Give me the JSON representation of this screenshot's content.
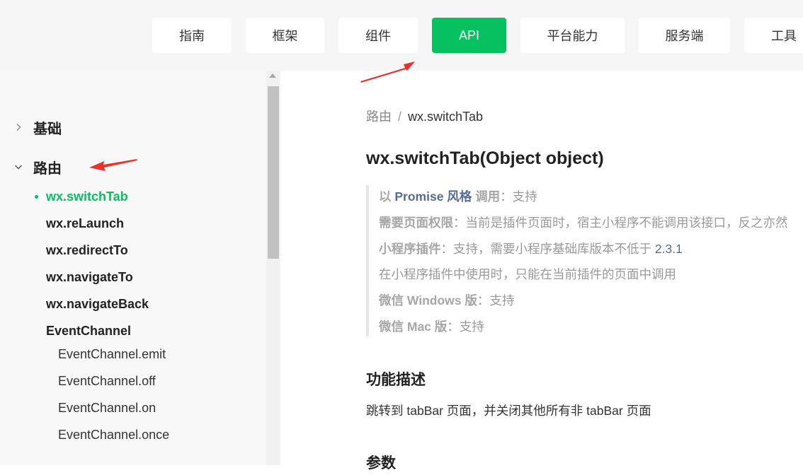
{
  "topnav": {
    "tabs": [
      {
        "label": "指南",
        "active": false
      },
      {
        "label": "框架",
        "active": false
      },
      {
        "label": "组件",
        "active": false
      },
      {
        "label": "API",
        "active": true
      },
      {
        "label": "平台能力",
        "active": false
      },
      {
        "label": "服务端",
        "active": false
      },
      {
        "label": "工具",
        "active": false
      }
    ],
    "accent_color": "#07c160"
  },
  "sidebar": {
    "sections": [
      {
        "label": "基础",
        "expanded": false,
        "icon": "chevron-right-icon"
      },
      {
        "label": "路由",
        "expanded": true,
        "icon": "chevron-down-icon"
      }
    ],
    "items": [
      {
        "label": "wx.switchTab",
        "active": true
      },
      {
        "label": "wx.reLaunch",
        "active": false
      },
      {
        "label": "wx.redirectTo",
        "active": false
      },
      {
        "label": "wx.navigateTo",
        "active": false
      },
      {
        "label": "wx.navigateBack",
        "active": false
      },
      {
        "label": "EventChannel",
        "active": false
      }
    ],
    "subitems": [
      {
        "label": "EventChannel.emit"
      },
      {
        "label": "EventChannel.off"
      },
      {
        "label": "EventChannel.on"
      },
      {
        "label": "EventChannel.once"
      }
    ]
  },
  "content": {
    "breadcrumb": {
      "parent": "路由",
      "separator": "/",
      "current": "wx.switchTab"
    },
    "title": "wx.switchTab(Object object)",
    "info": {
      "promise_prefix": "以 ",
      "promise_link": "Promise 风格",
      "promise_suffix": " 调用",
      "promise_value": "：支持",
      "permission_key": "需要页面权限",
      "permission_value": "：当前是插件页面时，宿主小程序不能调用该接口，反之亦然",
      "plugin_key": "小程序插件",
      "plugin_value": "：支持，需要小程序基础库版本不低于 ",
      "plugin_version": "2.3.1",
      "plugin_note": "在小程序插件中使用时，只能在当前插件的页面中调用",
      "windows_key": "微信 Windows 版",
      "windows_value": "：支持",
      "mac_key": "微信 Mac 版",
      "mac_value": "：支持"
    },
    "description_heading": "功能描述",
    "description": "跳转到 tabBar 页面，并关闭其他所有非 tabBar 页面",
    "params_heading": "参数"
  },
  "annotations": {
    "arrow_color": "#e8342a"
  }
}
